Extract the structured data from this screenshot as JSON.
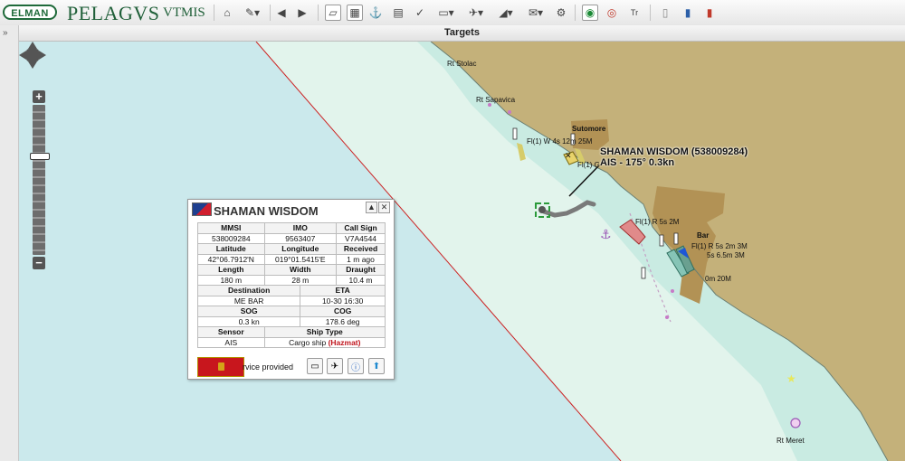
{
  "app": {
    "logo_elman": "ELMAN",
    "logo_pelagvs": "PELAGVS",
    "logo_vtmis": "VTMIS"
  },
  "toolbar": {
    "icons": [
      "home-icon",
      "measure-icon",
      "prev-icon",
      "next-icon",
      "select-icon",
      "layer-icon",
      "route-icon",
      "chart-icon",
      "tools-icon",
      "display-icon",
      "vessel-icon",
      "shape-icon",
      "mail-icon",
      "settings-icon",
      "track-icon",
      "target-icon",
      "text-icon",
      "db-icon",
      "panel-icon",
      "book-icon"
    ],
    "text_tool_label": "Tr"
  },
  "panel": {
    "title": "Targets",
    "expand_glyph": "»"
  },
  "map": {
    "colors": {
      "deep_water": "#cbe9ec",
      "shallow_water": "#e2f4ec",
      "land": "#c4b17a",
      "urban": "#b29255",
      "boundary_line": "#cc2222"
    },
    "labels": {
      "rt_stolac": "Rt Stolac",
      "rt_sapavica": "Rt Sapavica",
      "sutomore": "Sutomore",
      "light_1": "Fl(1) W 4s 12m 25M",
      "light_2": "Fl(1) G",
      "light_3": "Fl(1) R 5s 2M",
      "bar": "Bar",
      "light_4": "Fl(1) R 5s 2m 3M",
      "light_5": "5s 6.5m 3M",
      "light_6": "0m 20M",
      "rt_meret": "Rt Meret"
    },
    "target_label_line1": "SHAMAN WISDOM (538009284)",
    "target_label_line2": "AIS - 175° 0.3kn"
  },
  "popup": {
    "title": "SHAMAN WISDOM",
    "headers": {
      "mmsi": "MMSI",
      "imo": "IMO",
      "callsign": "Call Sign",
      "latitude": "Latitude",
      "longitude": "Longitude",
      "received": "Received",
      "length": "Length",
      "width": "Width",
      "draught": "Draught",
      "destination": "Destination",
      "eta": "ETA",
      "sog": "SOG",
      "cog": "COG",
      "sensor": "Sensor",
      "ship_type": "Ship Type"
    },
    "values": {
      "mmsi": "538009284",
      "imo": "9563407",
      "callsign": "V7A4544",
      "latitude": "42°06.7912'N",
      "longitude": "019°01.5415'E",
      "received": "1 m ago",
      "length": "180 m",
      "width": "28 m",
      "draught": "10.4 m",
      "destination": "ME BAR",
      "eta": "10-30 16:30",
      "sog": "0.3 kn",
      "cog": "178.6 deg",
      "sensor": "AIS",
      "ship_type": "Cargo ship",
      "hazmat": "(Hazmat)"
    },
    "service_text": "rvice provided",
    "minimize_glyph": "▲",
    "close_glyph": "✕"
  }
}
